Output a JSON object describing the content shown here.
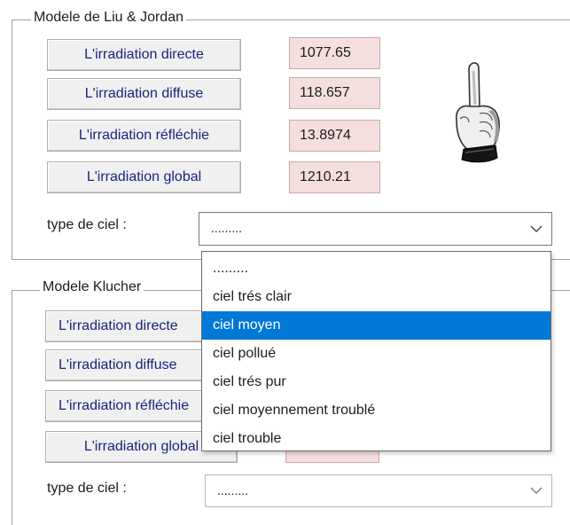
{
  "liu_jordan": {
    "title": "Modele de Liu & Jordan",
    "btn_directe": "L'irradiation directe",
    "btn_diffuse": "L'irradiation diffuse",
    "btn_reflechie": "L'irradiation réfléchie",
    "btn_global": "L'irradiation global",
    "val_directe": "1077.65",
    "val_diffuse": "118.657",
    "val_reflechie": "13.8974",
    "val_global": "1210.21",
    "sky_label": "type de ciel :",
    "sky_value": "........."
  },
  "klucher": {
    "title": "Modele Klucher",
    "btn_directe": "L'irradiation directe",
    "btn_diffuse": "L'irradiation diffuse",
    "btn_reflechie": "L'irradiation réfléchie",
    "btn_global": "L'irradiation global",
    "sky_label": "type de ciel :",
    "sky_value": "........."
  },
  "dropdown": {
    "options": [
      ".........",
      "ciel trés clair",
      "ciel moyen",
      "ciel pollué",
      "ciel trés pur",
      "ciel moyennement troublé",
      "ciel trouble"
    ],
    "selected_index": 2,
    "highlight_color": "#0078d7"
  },
  "icons": {
    "pointer": "pointing-hand-icon",
    "combo_arrow": "chevron-down-icon"
  },
  "colors": {
    "button_text": "#1a237e",
    "value_bg": "#f4dede"
  }
}
